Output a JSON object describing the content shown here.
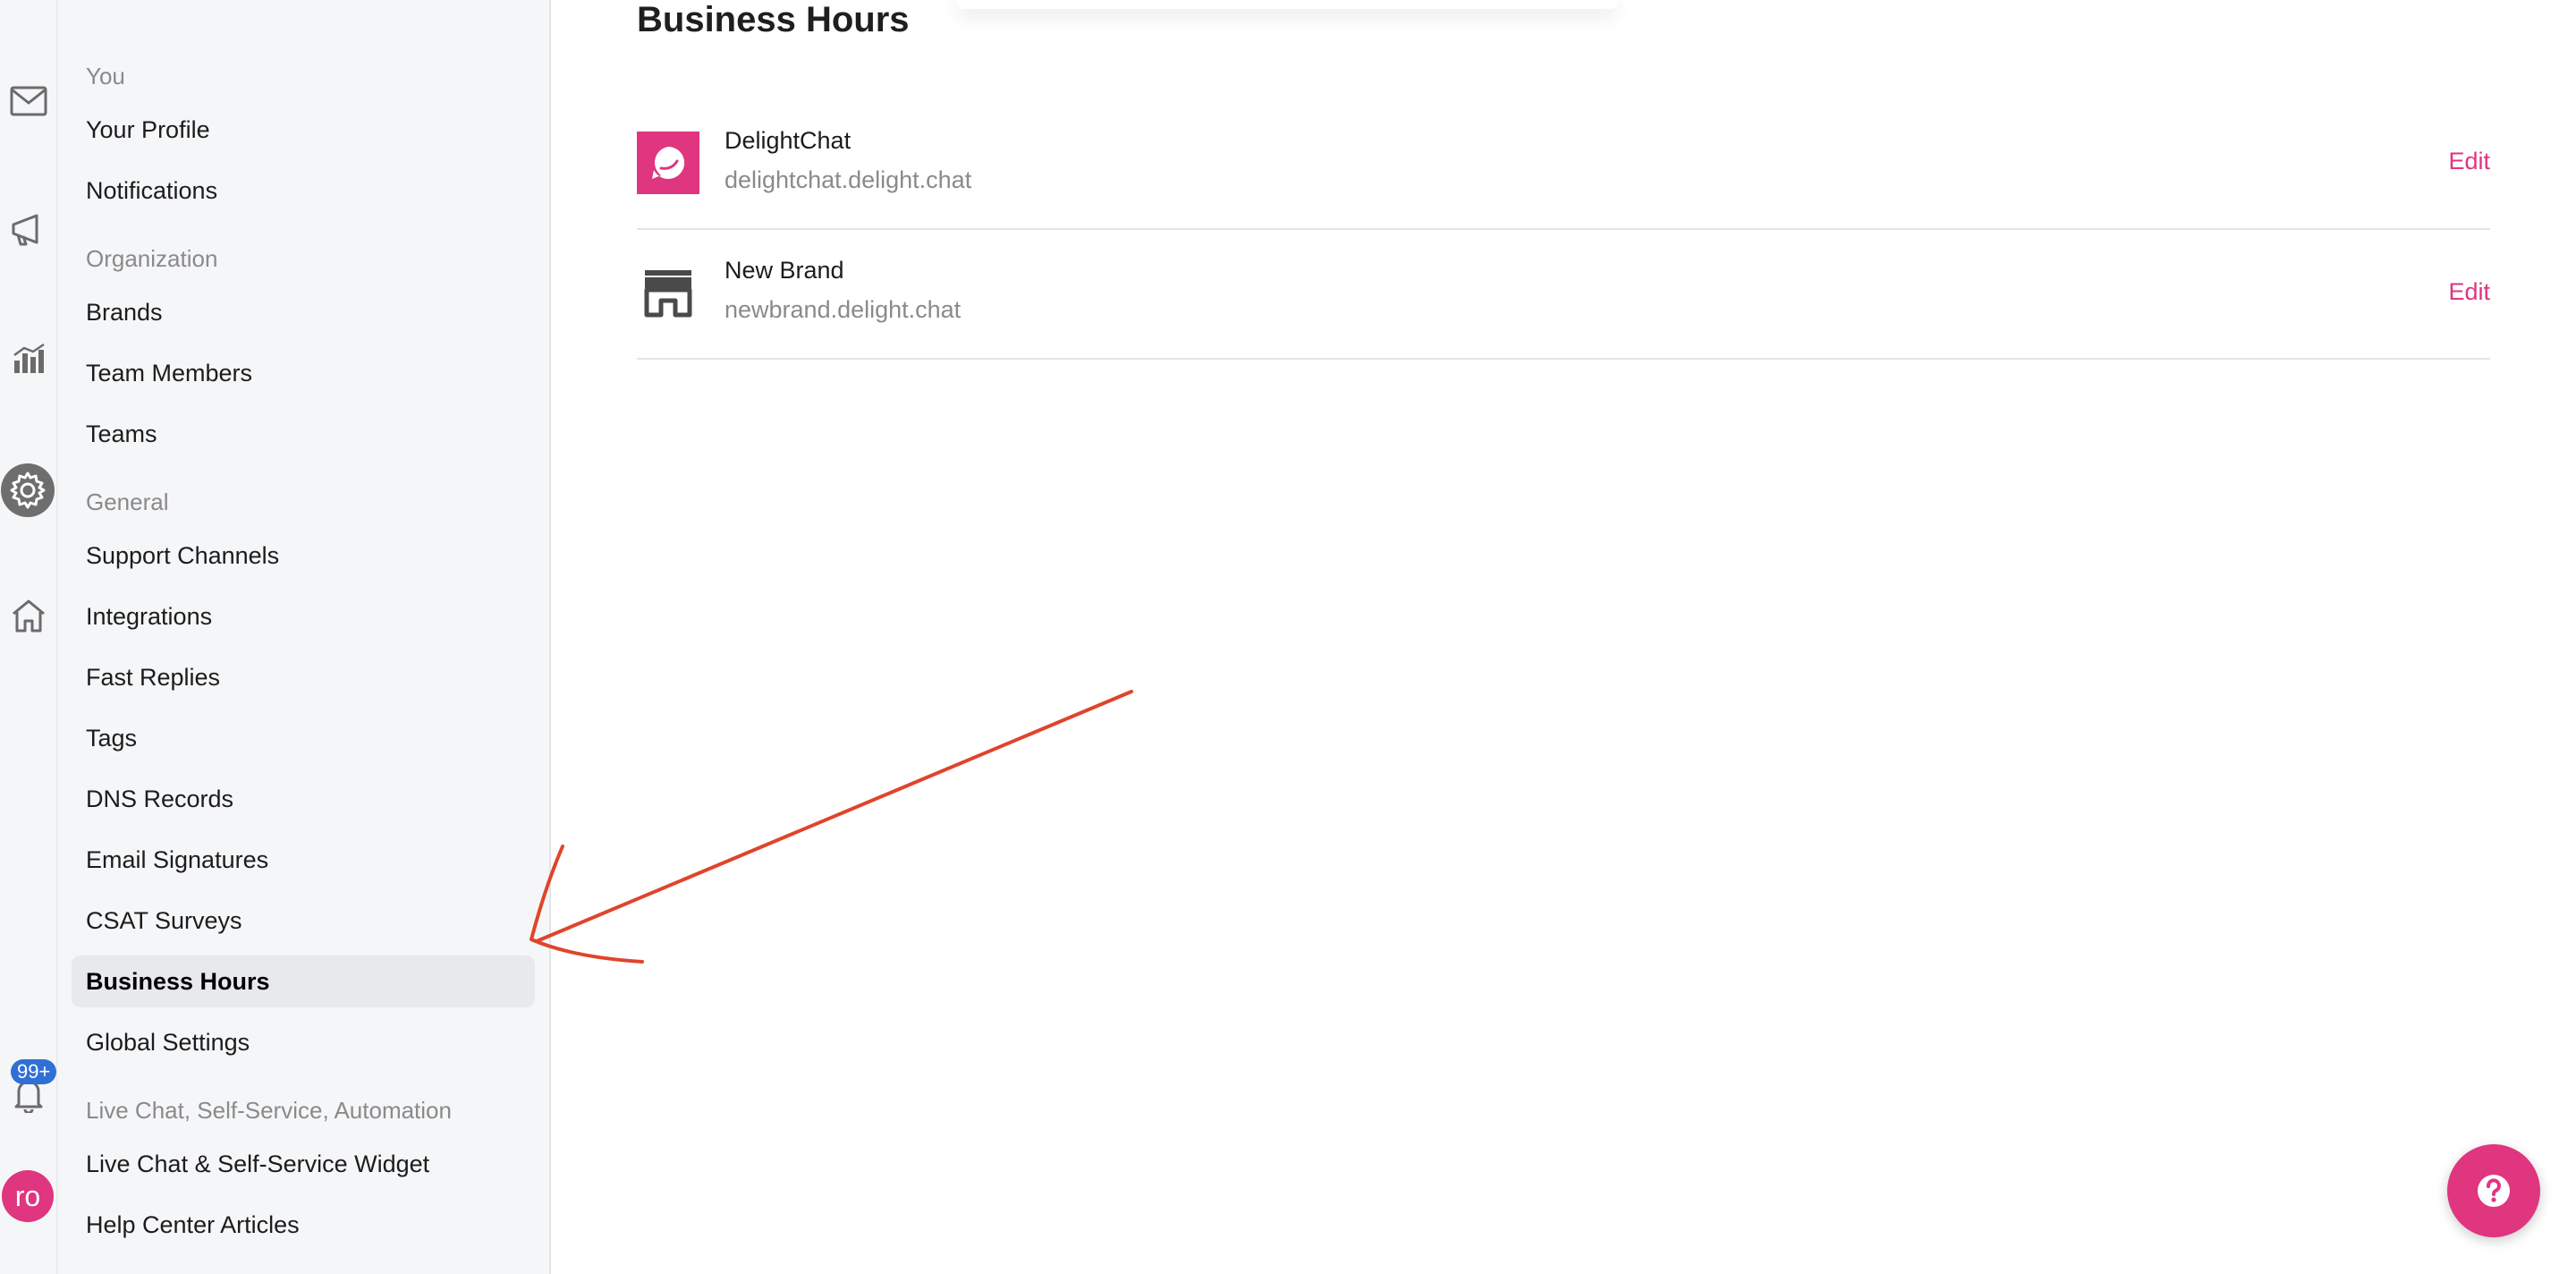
{
  "rail": {
    "icons": [
      "mail-icon",
      "megaphone-icon",
      "analytics-icon",
      "settings-gear-icon",
      "home-icon",
      "bell-icon"
    ],
    "notification_badge": "99+",
    "avatar_initials": "ro"
  },
  "nav": {
    "groups": {
      "you": "You",
      "organization": "Organization",
      "general": "General",
      "live_chat": "Live Chat, Self-Service, Automation"
    },
    "items": {
      "your_profile": "Your Profile",
      "notifications": "Notifications",
      "brands": "Brands",
      "team_members": "Team Members",
      "teams": "Teams",
      "support_channels": "Support Channels",
      "integrations": "Integrations",
      "fast_replies": "Fast Replies",
      "tags": "Tags",
      "dns_records": "DNS Records",
      "email_signatures": "Email Signatures",
      "csat_surveys": "CSAT Surveys",
      "business_hours": "Business Hours",
      "global_settings": "Global Settings",
      "live_chat_widget": "Live Chat & Self-Service Widget",
      "help_center_articles": "Help Center Articles"
    },
    "active_item": "Business Hours"
  },
  "main": {
    "title": "Business Hours",
    "brands": [
      {
        "name": "DelightChat",
        "domain": "delightchat.delight.chat",
        "action": "Edit",
        "logo": "delightchat-logo-icon"
      },
      {
        "name": "New Brand",
        "domain": "newbrand.delight.chat",
        "action": "Edit",
        "logo": "storefront-icon"
      }
    ]
  },
  "colors": {
    "accent": "#e0357f",
    "badge": "#2f6fd6",
    "annotation_arrow": "#e0442a",
    "sidebar_bg": "#f5f6f8"
  },
  "help_button_icon": "help-question-icon"
}
